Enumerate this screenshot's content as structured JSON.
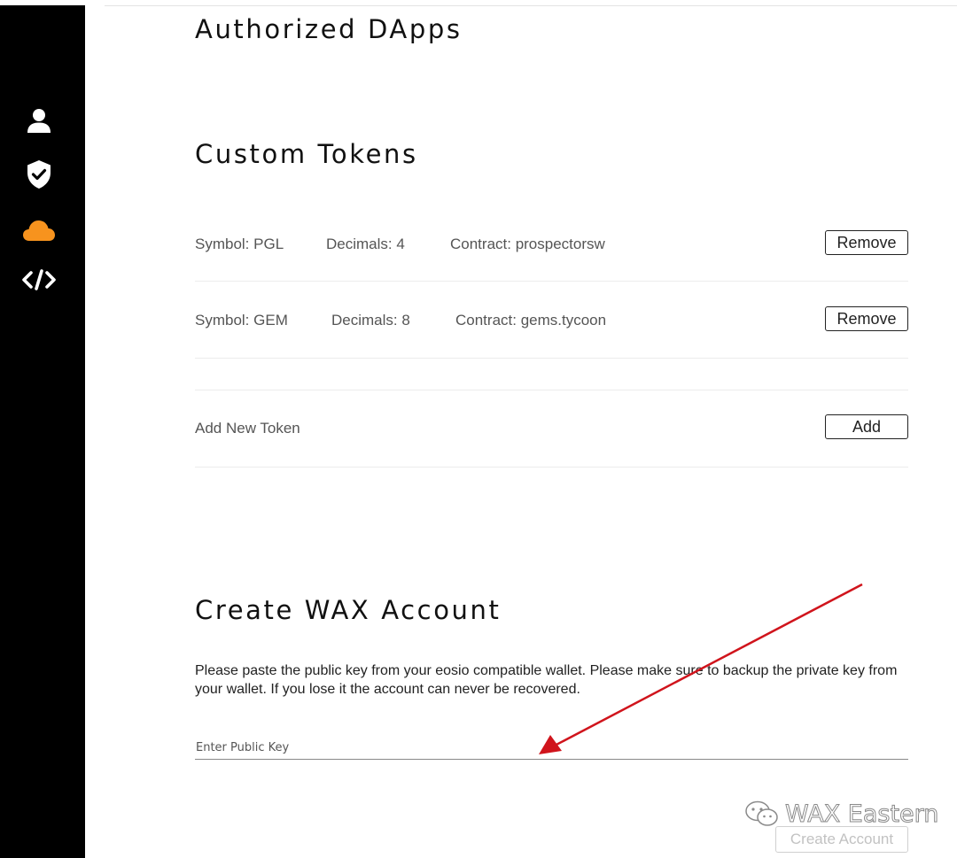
{
  "sidebar": {
    "items": [
      {
        "icon": "user-icon",
        "color": "#ffffff"
      },
      {
        "icon": "shield-check-icon",
        "color": "#ffffff"
      },
      {
        "icon": "cloud-icon",
        "color": "#f7931e"
      },
      {
        "icon": "code-icon",
        "color": "#ffffff"
      }
    ]
  },
  "authorized_dapps": {
    "title": "Authorized DApps"
  },
  "custom_tokens": {
    "title": "Custom Tokens",
    "tokens": [
      {
        "symbol": "Symbol: PGL",
        "decimals": "Decimals: 4",
        "contract": "Contract: prospectorsw",
        "remove_label": "Remove"
      },
      {
        "symbol": "Symbol: GEM",
        "decimals": "Decimals: 8",
        "contract": "Contract: gems.tycoon",
        "remove_label": "Remove"
      }
    ],
    "add_label": "Add New Token",
    "add_button": "Add"
  },
  "create_account": {
    "title": "Create WAX Account",
    "description": "Please paste the public key from your eosio compatible wallet. Please make sure to backup the private key from your wallet. If you lose it the account can never be recovered.",
    "key_placeholder": "Enter Public Key",
    "key_value": "",
    "button": "Create Account"
  },
  "annotation": {
    "color": "#d0141c"
  },
  "watermark": {
    "text": "WAX Eastern",
    "icon": "wechat-icon"
  }
}
